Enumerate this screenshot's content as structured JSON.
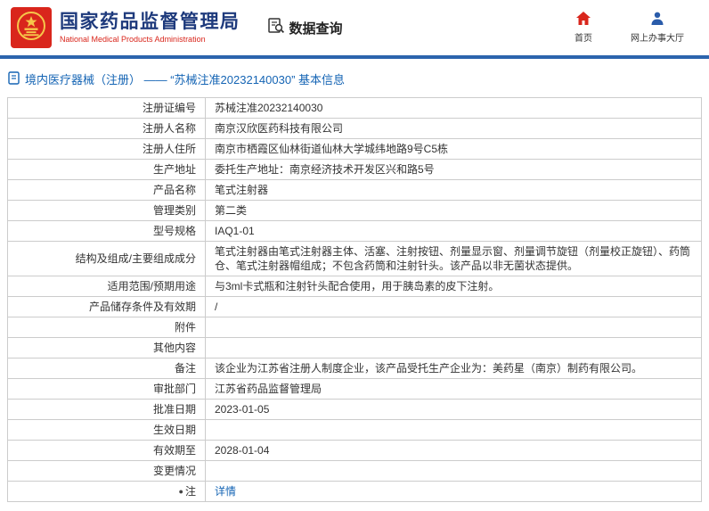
{
  "palette": {
    "brand_red": "#d9261c",
    "brand_navy": "#1e3a7c",
    "line_blue": "#2b64ad",
    "link_blue": "#1464b4",
    "border_gray": "#cccccc"
  },
  "header": {
    "agency_name_zh": "国家药品监督管理局",
    "agency_name_en": "National Medical Products Administration",
    "section_title": "数据查询",
    "nav": [
      {
        "label": "首页",
        "icon": "home-icon"
      },
      {
        "label": "网上办事大厅",
        "icon": "person-icon"
      }
    ]
  },
  "breadcrumb": {
    "text": "境内医疗器械（注册） —— “苏械注准20232140030” 基本信息"
  },
  "icons": {
    "note": "●"
  },
  "table": {
    "rows": [
      {
        "label": "注册证编号",
        "value": "苏械注准20232140030"
      },
      {
        "label": "注册人名称",
        "value": "南京汉欣医药科技有限公司"
      },
      {
        "label": "注册人住所",
        "value": "南京市栖霞区仙林街道仙林大学城纬地路9号C5栋"
      },
      {
        "label": "生产地址",
        "value": "委托生产地址：南京经济技术开发区兴和路5号"
      },
      {
        "label": "产品名称",
        "value": "笔式注射器"
      },
      {
        "label": "管理类别",
        "value": "第二类"
      },
      {
        "label": "型号规格",
        "value": "IAQ1-01"
      },
      {
        "label": "结构及组成/主要组成成分",
        "value": "笔式注射器由笔式注射器主体、活塞、注射按钮、剂量显示窗、剂量调节旋钮（剂量校正旋钮）、药筒仓、笔式注射器帽组成；不包含药筒和注射针头。该产品以非无菌状态提供。"
      },
      {
        "label": "适用范围/预期用途",
        "value": "与3ml卡式瓶和注射针头配合使用，用于胰岛素的皮下注射。"
      },
      {
        "label": "产品储存条件及有效期",
        "value": "/"
      },
      {
        "label": "附件",
        "value": ""
      },
      {
        "label": "其他内容",
        "value": ""
      },
      {
        "label": "备注",
        "value": "该企业为江苏省注册人制度企业，该产品受托生产企业为：美药星（南京）制药有限公司。"
      },
      {
        "label": "审批部门",
        "value": "江苏省药品监督管理局"
      },
      {
        "label": "批准日期",
        "value": "2023-01-05"
      },
      {
        "label": "生效日期",
        "value": ""
      },
      {
        "label": "有效期至",
        "value": "2028-01-04"
      },
      {
        "label": "变更情况",
        "value": ""
      },
      {
        "label": "注",
        "value": "详情"
      }
    ]
  }
}
